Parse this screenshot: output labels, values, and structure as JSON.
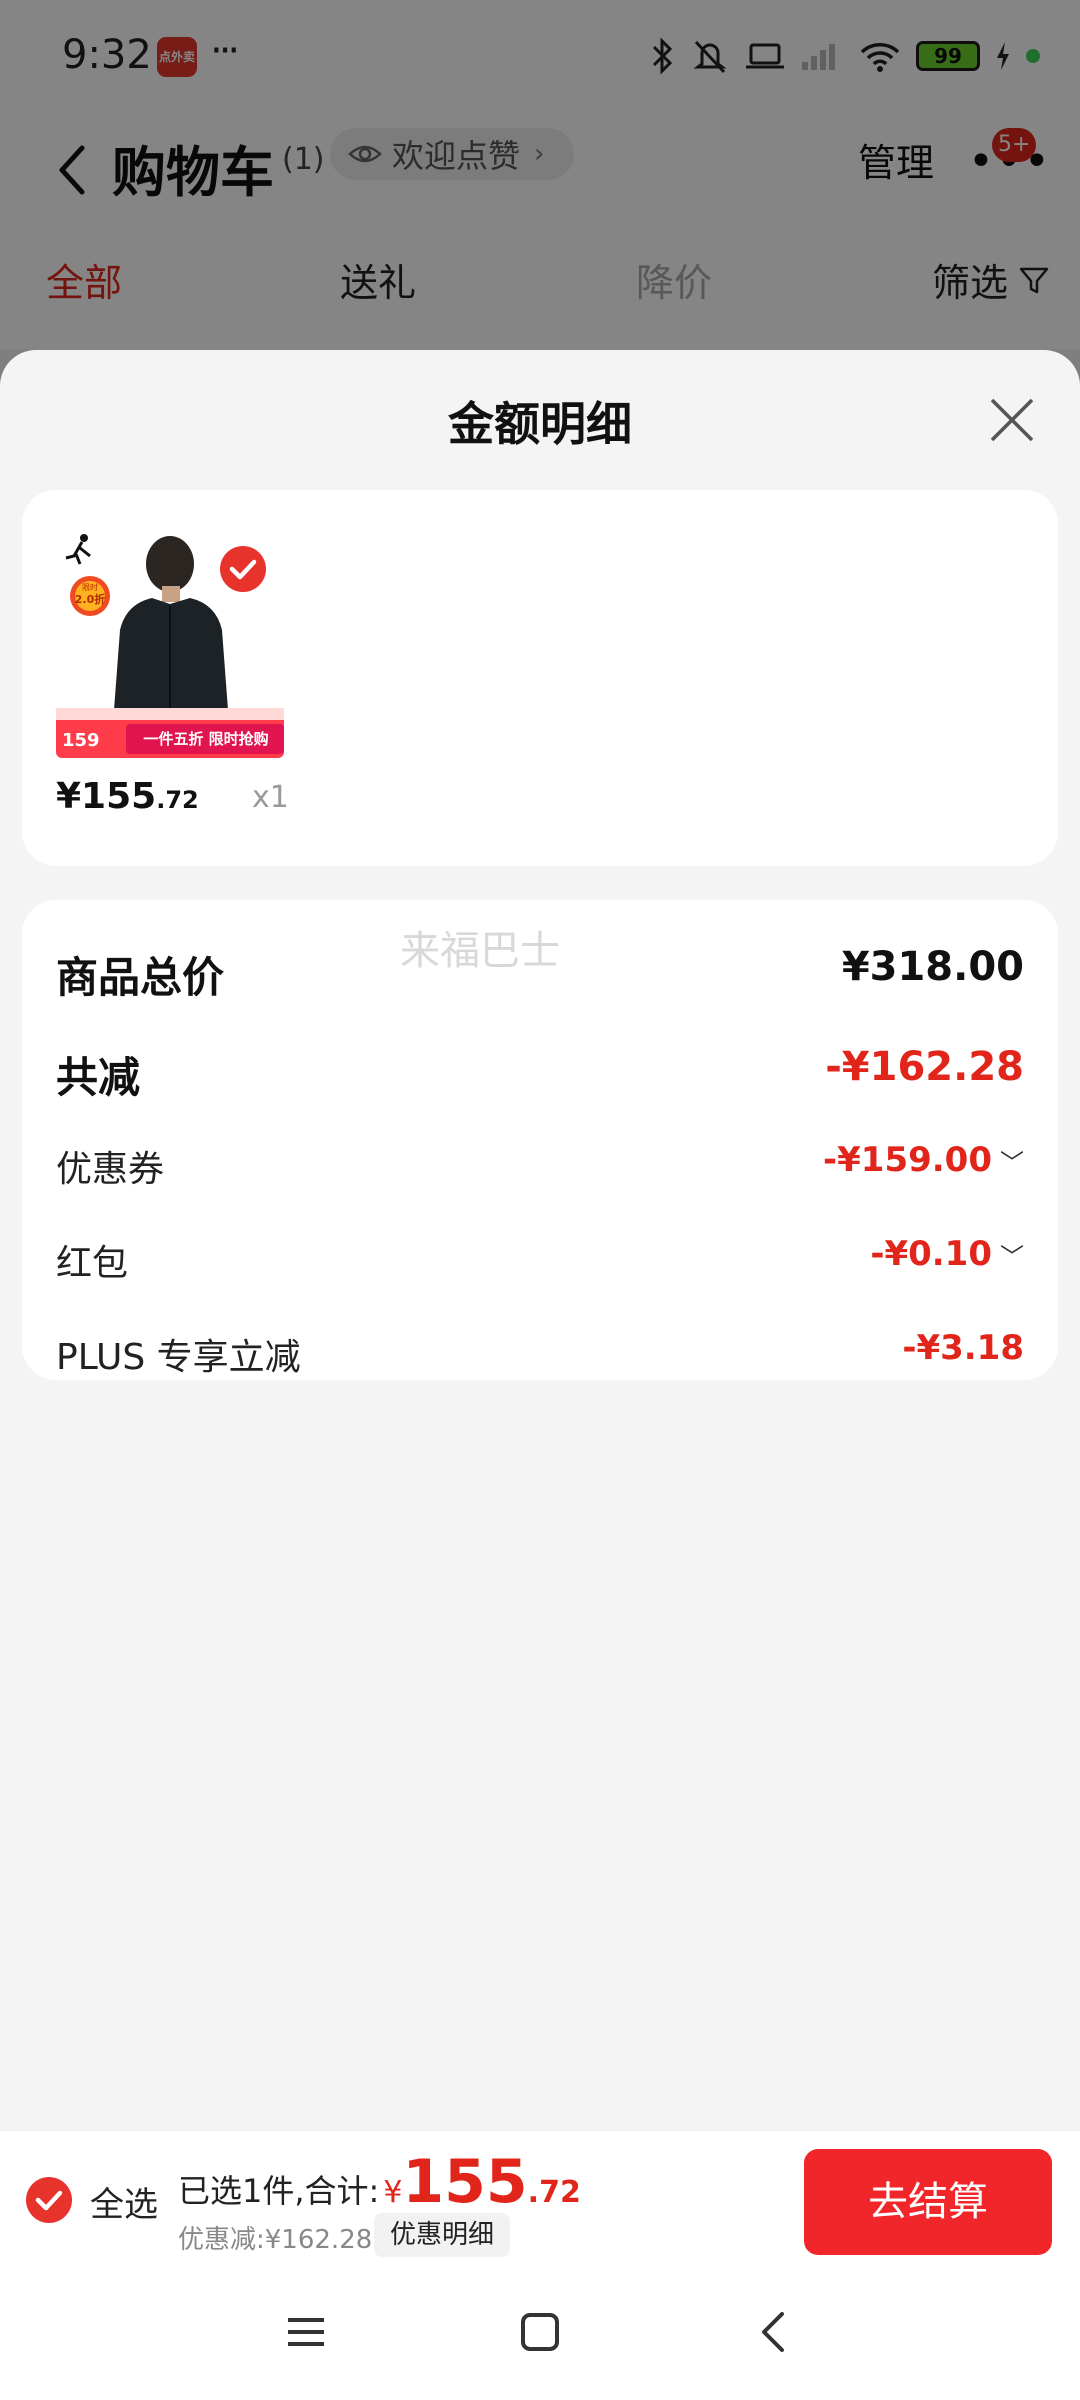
{
  "status_bar": {
    "time": "9:32",
    "app_icon_text": "点外卖",
    "overflow": "···",
    "battery": "99",
    "icons": [
      "bluetooth-icon",
      "mute-icon",
      "laptop-icon",
      "signal-icon",
      "wifi-icon",
      "battery-icon",
      "charging-icon"
    ]
  },
  "nav": {
    "title": "购物车",
    "count": "(1)",
    "pill_text": "欢迎点赞",
    "manage": "管理",
    "badge": "5+"
  },
  "tabs": [
    {
      "label": "全部",
      "active": true
    },
    {
      "label": "送礼",
      "active": false
    },
    {
      "label": "降价",
      "active": false
    },
    {
      "label": "筛选",
      "active": false
    }
  ],
  "sheet": {
    "title": "金额明细",
    "product": {
      "price_int": "¥155",
      "price_dec": ".72",
      "qty": "x1",
      "image_tag_top": "限时",
      "image_tag_bottom": "2.0折",
      "banner_price": "159",
      "banner_text": "一件五折 限时抢购"
    },
    "rows": [
      {
        "label": "商品总价",
        "value": "¥318.00",
        "style": "main",
        "red": false,
        "chevron": false
      },
      {
        "label": "共减",
        "value": "-¥162.28",
        "style": "main",
        "red": true,
        "chevron": false
      },
      {
        "label": "优惠券",
        "value": "-¥159.00",
        "style": "sub",
        "red": true,
        "chevron": true
      },
      {
        "label": "红包",
        "value": "-¥0.10",
        "style": "sub",
        "red": true,
        "chevron": true
      },
      {
        "label": "PLUS 专享立减",
        "value": "-¥3.18",
        "style": "sub",
        "red": true,
        "chevron": false
      }
    ],
    "watermark": "来福巴士"
  },
  "checkout": {
    "select_all": "全选",
    "selected_text": "已选1件,合计:",
    "yen": "¥",
    "total_int": "155",
    "total_dec": ".72",
    "discount_text": "优惠减:¥162.28",
    "detail_button": "优惠明细",
    "submit": "去结算"
  },
  "colors": {
    "accent": "#e1251b",
    "button": "#f0262b",
    "sheet_bg": "#f4f4f4"
  }
}
